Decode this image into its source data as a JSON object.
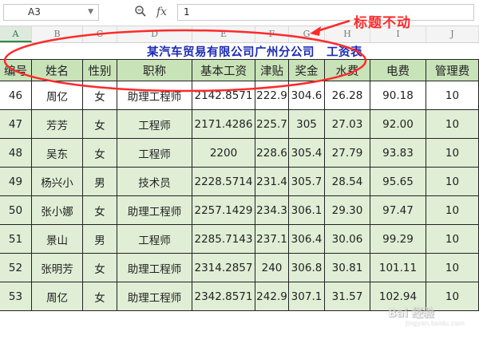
{
  "formula_bar": {
    "cell_ref": "A3",
    "formula_value": "1",
    "zoom_icon": "magnifier-icon",
    "fx_label": "fx"
  },
  "columns": [
    "A",
    "B",
    "C",
    "D",
    "E",
    "F",
    "G",
    "H",
    "I",
    "J"
  ],
  "sheet": {
    "title": "某汽车贸易有限公司广州分公司　工资表",
    "headers": [
      "编号",
      "姓名",
      "性别",
      "职称",
      "基本工资",
      "津贴",
      "奖金",
      "水费",
      "电费",
      "管理费"
    ],
    "rows": [
      [
        "46",
        "周亿",
        "女",
        "助理工程师",
        "2142.8571",
        "222.9",
        "304.6",
        "26.28",
        "90.18",
        "10"
      ],
      [
        "47",
        "芳芳",
        "女",
        "工程师",
        "2171.4286",
        "225.7",
        "305",
        "27.03",
        "92.00",
        "10"
      ],
      [
        "48",
        "吴东",
        "女",
        "工程师",
        "2200",
        "228.6",
        "305.4",
        "27.79",
        "93.83",
        "10"
      ],
      [
        "49",
        "杨兴小",
        "男",
        "技术员",
        "2228.5714",
        "231.4",
        "305.7",
        "28.54",
        "95.65",
        "10"
      ],
      [
        "50",
        "张小娜",
        "女",
        "助理工程师",
        "2257.1429",
        "234.3",
        "306.1",
        "29.30",
        "97.47",
        "10"
      ],
      [
        "51",
        "景山",
        "男",
        "工程师",
        "2285.7143",
        "237.1",
        "306.4",
        "30.06",
        "99.29",
        "10"
      ],
      [
        "52",
        "张明芳",
        "女",
        "助理工程师",
        "2314.2857",
        "240",
        "306.8",
        "30.81",
        "101.11",
        "10"
      ],
      [
        "53",
        "周亿",
        "女",
        "助理工程师",
        "2342.8571",
        "242.9",
        "307.1",
        "31.57",
        "102.94",
        "10"
      ]
    ]
  },
  "annotation": {
    "text": "标题不动",
    "color": "#ff2a2a"
  },
  "watermark": {
    "text": "Bai 经验",
    "sub": "jingyan.baidu.com"
  },
  "colors": {
    "header_fill": "#c9e3b9",
    "row_fill": "#dfeed5",
    "title_color": "#1c2bb3"
  }
}
